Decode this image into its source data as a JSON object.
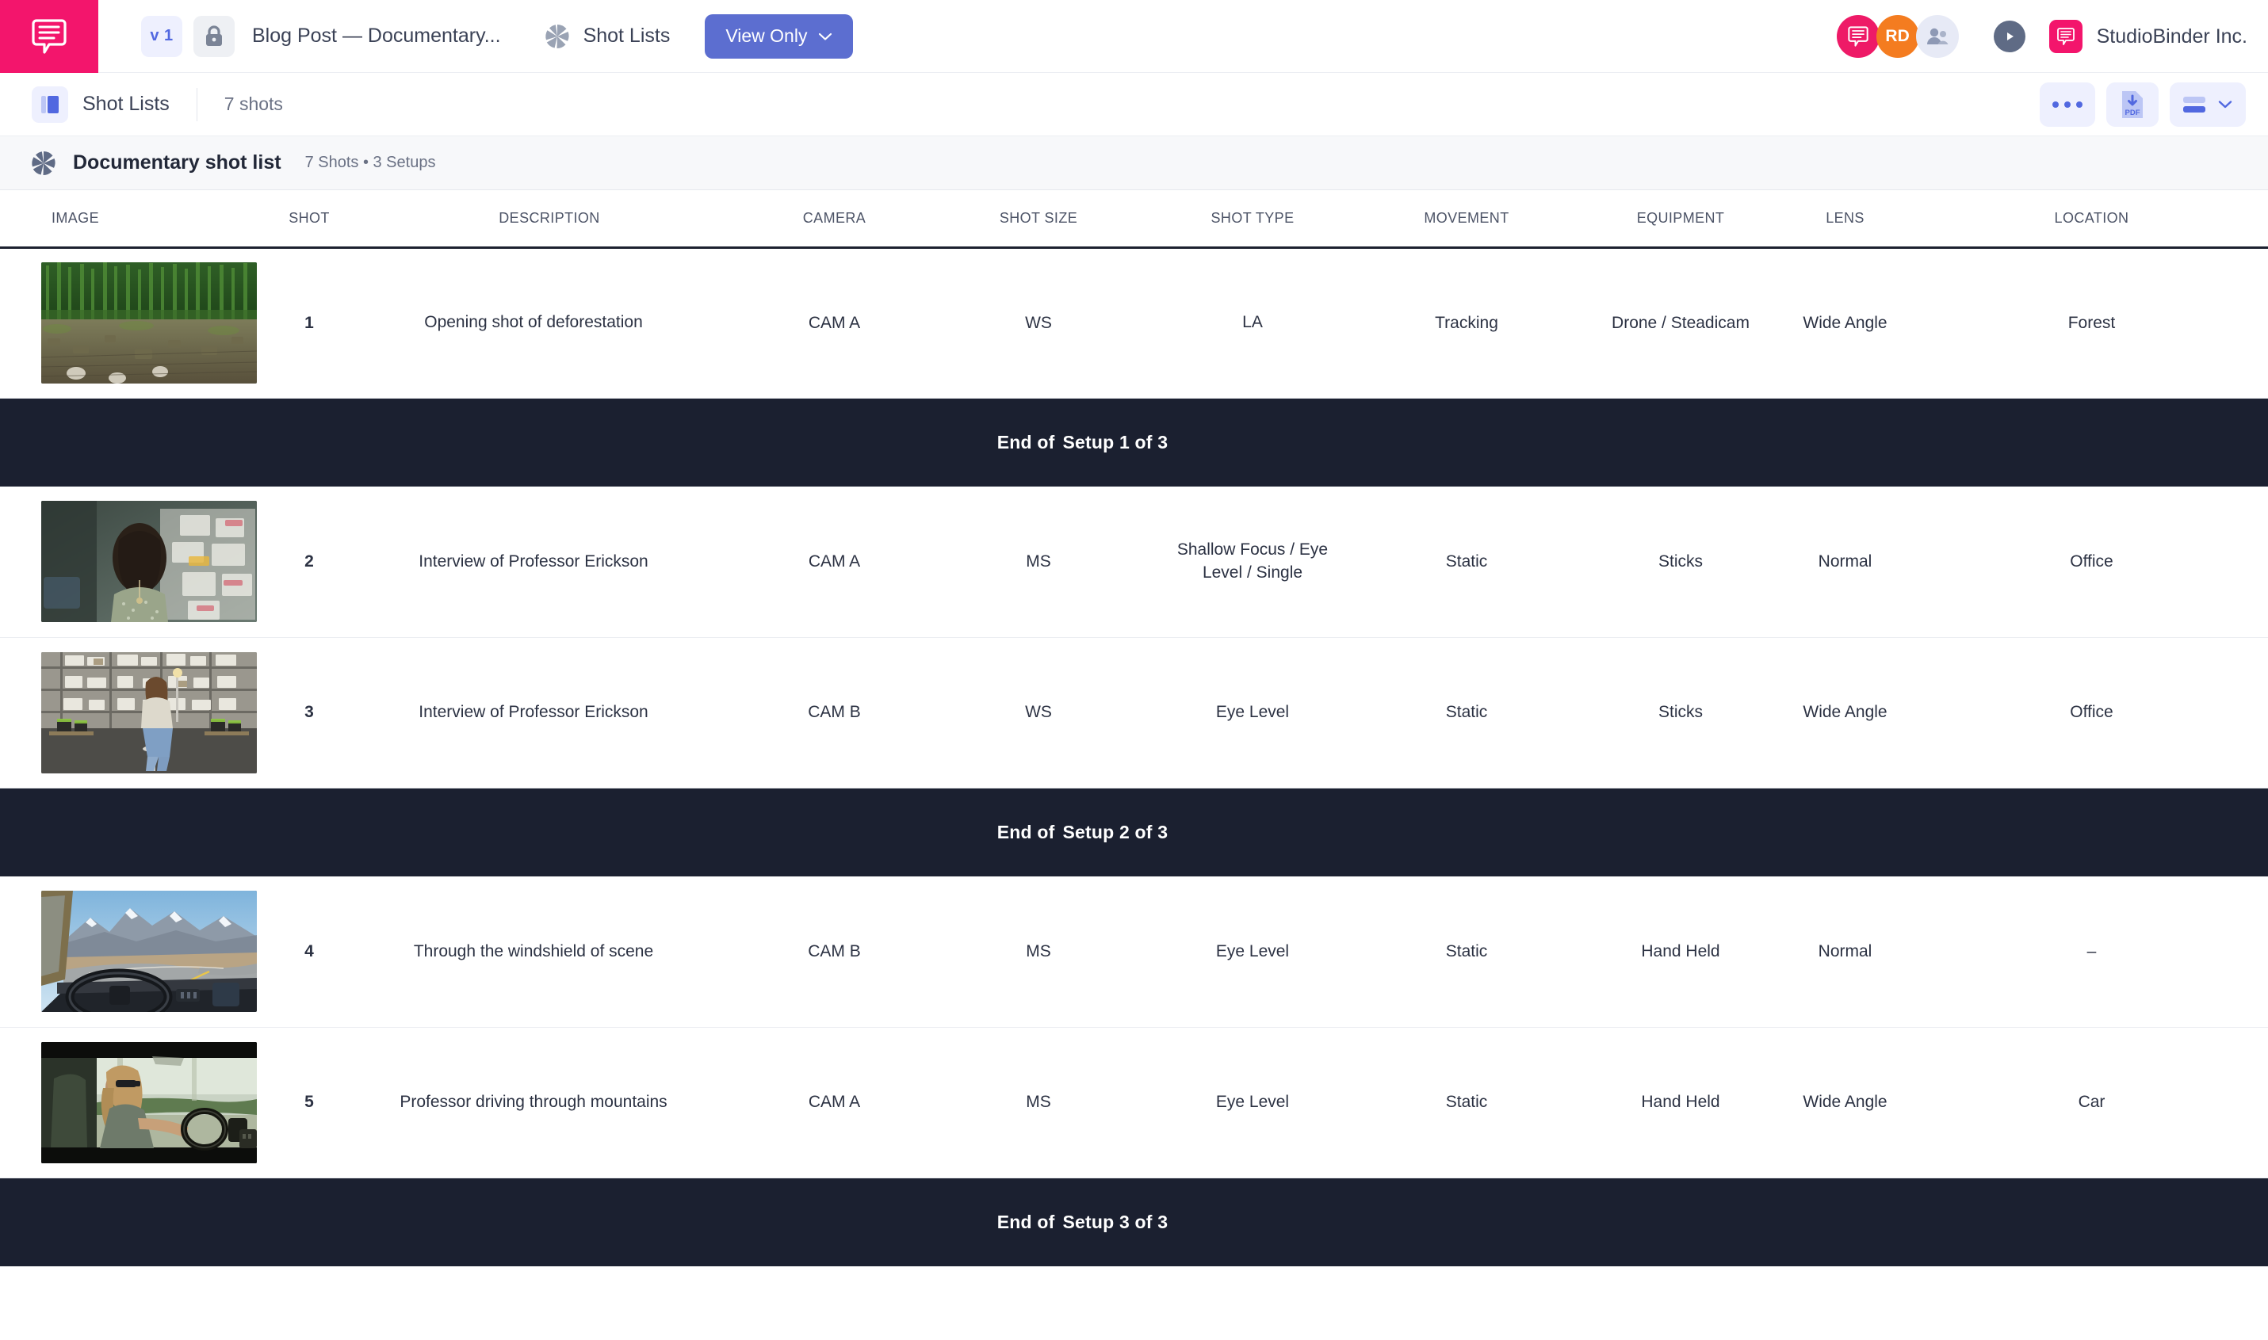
{
  "topbar": {
    "version_chip": "v 1",
    "lock_icon": "lock-icon",
    "document_title": "Blog Post — Documentary...",
    "nav_label": "Shot Lists",
    "view_mode_button": "View Only",
    "avatars": [
      {
        "name": "studiobinder-avatar",
        "initials": "",
        "color": "#ee1a67"
      },
      {
        "name": "user-avatar-rd",
        "initials": "RD",
        "color": "#f47c20"
      },
      {
        "name": "team-avatar",
        "initials": "",
        "color": "#e7eaf6"
      }
    ],
    "company_name": "StudioBinder Inc."
  },
  "subbar": {
    "title": "Shot Lists",
    "count": "7 shots",
    "more_button": "more-options",
    "pdf_button": "PDF",
    "layout_button": "layout"
  },
  "list_header": {
    "name": "Documentary shot list",
    "meta": "7 Shots • 3 Setups"
  },
  "table": {
    "columns": [
      "IMAGE",
      "SHOT",
      "DESCRIPTION",
      "CAMERA",
      "SHOT SIZE",
      "SHOT TYPE",
      "MOVEMENT",
      "EQUIPMENT",
      "LENS",
      "LOCATION"
    ],
    "rows": [
      {
        "kind": "shot",
        "thumb": "forest-clearcut-thumbnail",
        "shot": "1",
        "description": "Opening shot of deforestation",
        "camera": "CAM A",
        "shot_size": "WS",
        "shot_type": "LA",
        "movement": "Tracking",
        "equipment": "Drone / Steadicam",
        "lens": "Wide Angle",
        "location": "Forest"
      },
      {
        "kind": "setup",
        "prefix": "End of",
        "label": "Setup 1 of 3"
      },
      {
        "kind": "shot",
        "thumb": "interview-woman-warehouse-thumbnail",
        "shot": "2",
        "description": "Interview of Professor Erickson",
        "camera": "CAM A",
        "shot_size": "MS",
        "shot_type": "Shallow Focus / Eye Level / Single",
        "movement": "Static",
        "equipment": "Sticks",
        "lens": "Normal",
        "location": "Office"
      },
      {
        "kind": "shot",
        "thumb": "woman-on-stool-warehouse-thumbnail",
        "shot": "3",
        "description": "Interview of Professor Erickson",
        "camera": "CAM B",
        "shot_size": "WS",
        "shot_type": "Eye Level",
        "movement": "Static",
        "equipment": "Sticks",
        "lens": "Wide Angle",
        "location": "Office"
      },
      {
        "kind": "setup",
        "prefix": "End of",
        "label": "Setup 2 of 3"
      },
      {
        "kind": "shot",
        "thumb": "windshield-mountain-road-thumbnail",
        "shot": "4",
        "description": "Through the windshield of scene",
        "camera": "CAM B",
        "shot_size": "MS",
        "shot_type": "Eye Level",
        "movement": "Static",
        "equipment": "Hand Held",
        "lens": "Normal",
        "location": "–"
      },
      {
        "kind": "shot",
        "thumb": "woman-driving-car-thumbnail",
        "shot": "5",
        "description": "Professor driving through mountains",
        "camera": "CAM A",
        "shot_size": "MS",
        "shot_type": "Eye Level",
        "movement": "Static",
        "equipment": "Hand Held",
        "lens": "Wide Angle",
        "location": "Car"
      },
      {
        "kind": "setup",
        "prefix": "End of",
        "label": "Setup 3 of 3"
      }
    ]
  },
  "colors": {
    "brand_pink": "#f3156c",
    "accent_blue": "#5c6ed0",
    "chip_blue_bg": "#eef0fe",
    "setup_bar": "#1b2030",
    "text_dark": "#2c3243"
  }
}
